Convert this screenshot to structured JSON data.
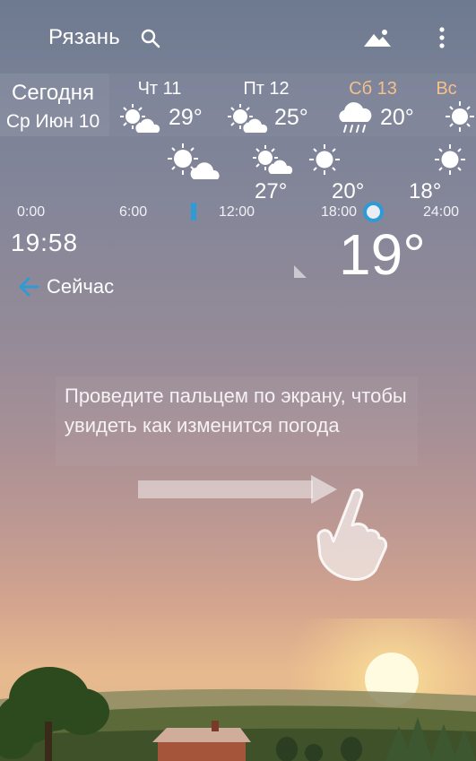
{
  "header": {
    "city": "Рязань",
    "icons": [
      "search-icon",
      "mountain-icon",
      "more-vert-icon"
    ]
  },
  "today": {
    "label": "Сегодня",
    "date": "Ср Июн 10"
  },
  "days": [
    {
      "name": "Чт 11",
      "temp": "29°",
      "icon": "sun-cloud-icon",
      "color": "#ffffff"
    },
    {
      "name": "Пт 12",
      "temp": "25°",
      "icon": "sun-cloud-icon",
      "color": "#ffffff"
    },
    {
      "name": "Сб 13",
      "temp": "20°",
      "icon": "rain-cloud-icon",
      "color": "#f6c08a"
    },
    {
      "name": "Вс",
      "temp": "",
      "icon": "sun-icon",
      "color": "#f6c08a"
    }
  ],
  "hourly": {
    "temps": [
      "27°",
      "20°",
      "18°"
    ],
    "labels": [
      "0:00",
      "6:00",
      "12:00",
      "18:00",
      "24:00"
    ]
  },
  "now": {
    "time": "19:58",
    "temperature": "19°",
    "label": "Сейчас"
  },
  "hint": {
    "text": "Проведите пальцем по экрану, чтобы увидеть как изменится погода"
  },
  "colors": {
    "accent": "#2e9ad6",
    "weekend": "#f6c08a"
  }
}
